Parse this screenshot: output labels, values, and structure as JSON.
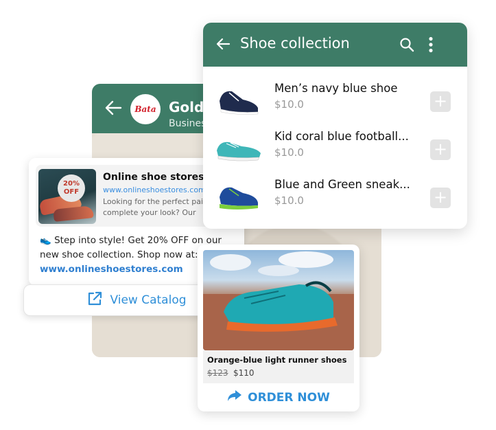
{
  "chat": {
    "contact_name": "Golde",
    "contact_subtitle": "Busines",
    "logo_text": "Bata"
  },
  "ad": {
    "badge": "20% OFF",
    "title": "Online shoe stores",
    "url": "www.onlineshoestores.com",
    "description": "Looking for the perfect pair to complete your look? Our",
    "body": "👟 Step into style! Get 20% OFF on our new shoe collection. Shop now at:",
    "body_url": "www.onlineshoestores.com",
    "button": "View Catalog"
  },
  "collection": {
    "title": "Shoe collection",
    "products": [
      {
        "name": "Men’s navy blue shoe",
        "price": "$10.0"
      },
      {
        "name": "Kid coral blue football...",
        "price": "$10.0"
      },
      {
        "name": "Blue and Green sneak...",
        "price": "$10.0"
      }
    ]
  },
  "order": {
    "title": "Orange-blue light runner shoes",
    "old_price": "$123",
    "new_price": "$110",
    "button": "ORDER NOW"
  },
  "colors": {
    "header_green": "#3e7c67",
    "link_blue": "#2f8fd8"
  },
  "icons": [
    "back-arrow-icon",
    "search-icon",
    "more-vert-icon",
    "plus-icon",
    "external-link-icon",
    "share-arrow-icon"
  ]
}
